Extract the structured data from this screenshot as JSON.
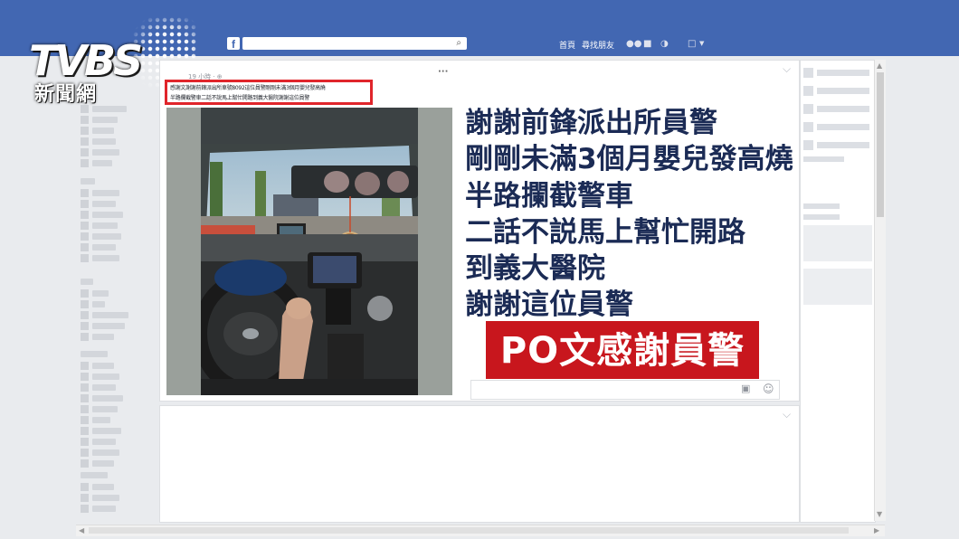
{
  "topbar": {
    "nav_home": "首頁",
    "nav_find_friends": "尋找朋友",
    "search_placeholder": ""
  },
  "logo": {
    "brand": "TVBS",
    "sub": "新聞網"
  },
  "post": {
    "time": "19 小時 · ⊕",
    "caption_line1": "感謝文謝謝前鋒派出所車號8092這位員警剛剛未滿3個月嬰兒發高燒",
    "caption_line2": "半路攔截警車二話不說馬上幫忙開路到義大醫院謝謝這位員警"
  },
  "overlay": {
    "lines": [
      "謝謝前鋒派出所員警",
      "剛剛未滿3個月嬰兒發高燒",
      "半路攔截警車",
      "二話不説馬上幫忙開路",
      "到義大醫院",
      "謝謝這位員警"
    ],
    "headline": "PO文感謝員警"
  },
  "colors": {
    "topbar": "#4267b2",
    "headline_bg": "#c8161d",
    "overlay_text": "#1b2b55",
    "highlight_border": "#e0252b"
  },
  "icons": [
    "facebook-icon",
    "search-icon",
    "friends-icon",
    "messages-icon",
    "globe-icon",
    "account-icon",
    "chevron-down-icon",
    "camera-icon",
    "smiley-icon"
  ]
}
